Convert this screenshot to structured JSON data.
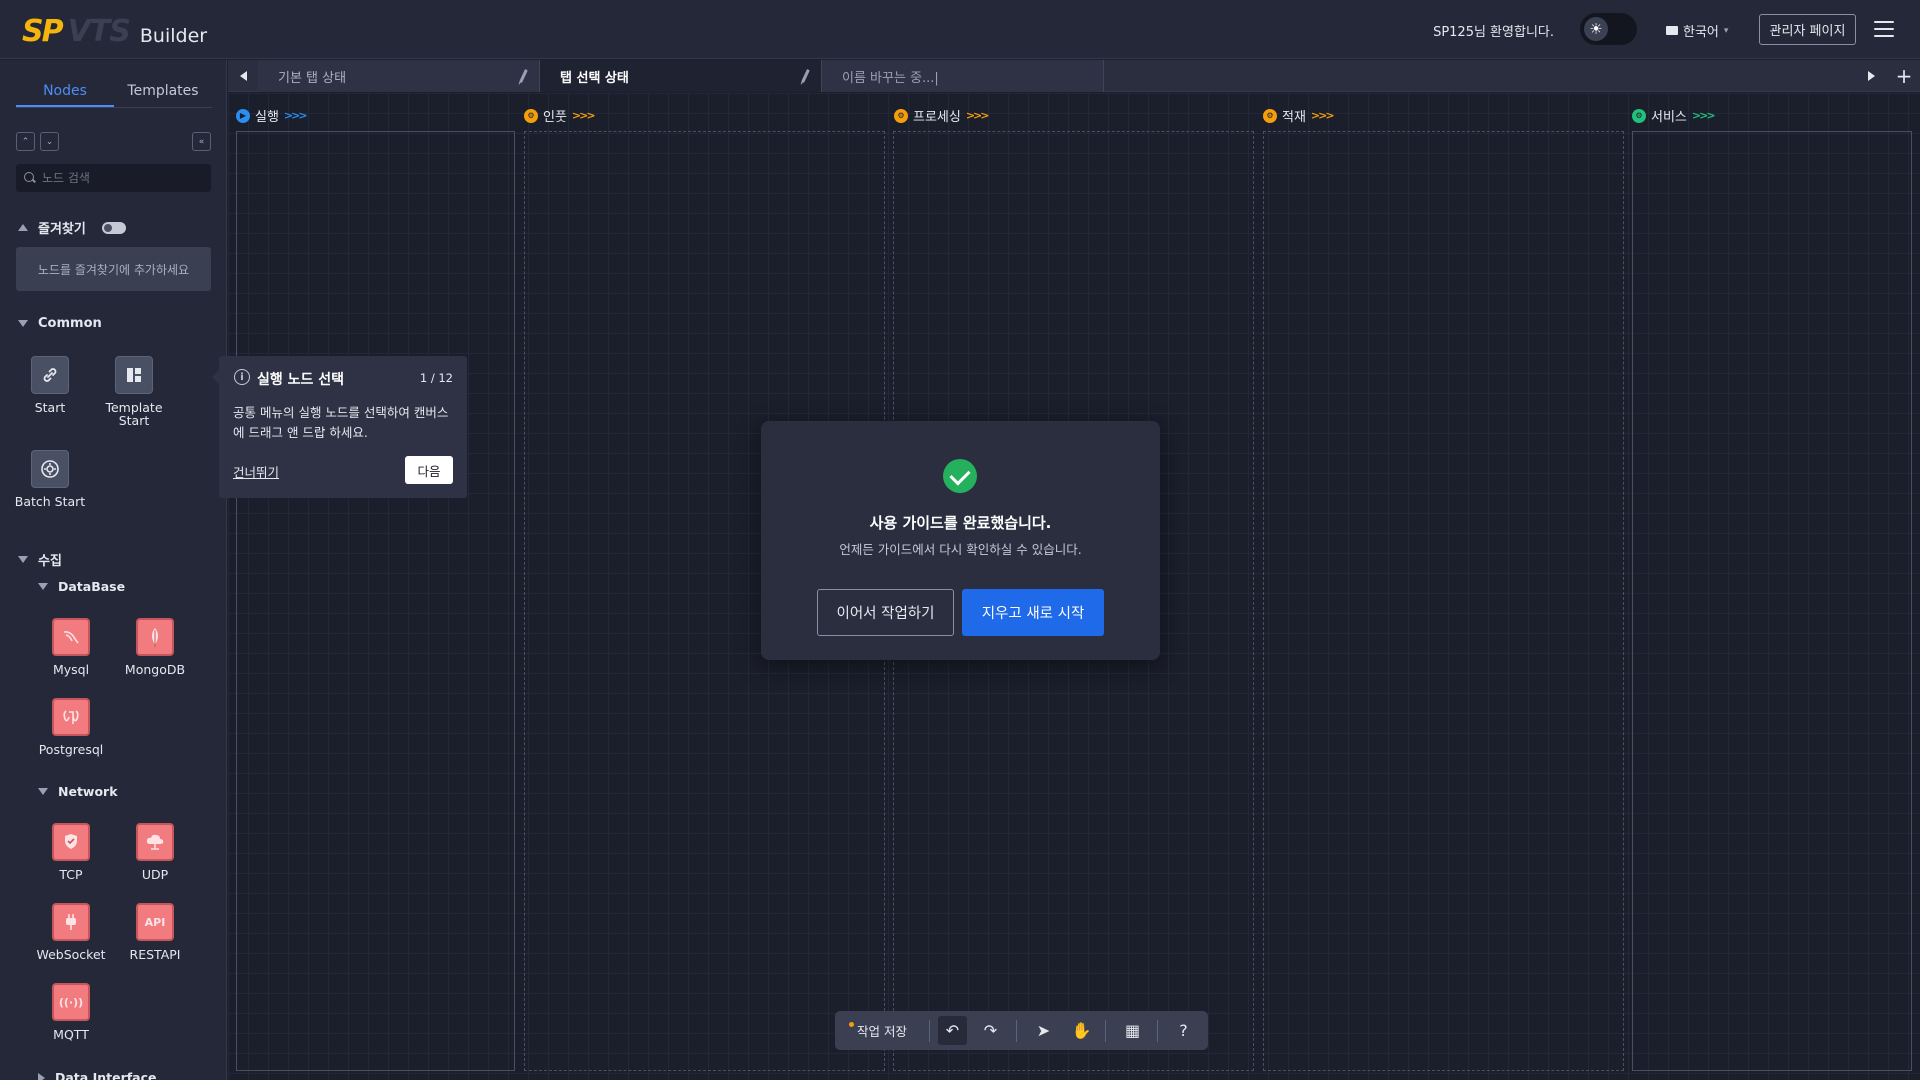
{
  "header": {
    "logo_sp": "SP",
    "logo_vts": "VTS",
    "logo_builder": "Builder",
    "welcome": "SP125님 환영합니다.",
    "language": "한국어",
    "admin_button": "관리자 페이지",
    "theme_icon": "sun-icon"
  },
  "sidebar": {
    "tabs": [
      "Nodes",
      "Templates"
    ],
    "active_tab": "Nodes",
    "search_placeholder": "노드 검색",
    "favorites": {
      "title": "즐겨찾기",
      "empty_message": "노드를 즐겨찾기에 추가하세요"
    },
    "common": {
      "title": "Common",
      "nodes": [
        "Start",
        "Template Start",
        "Batch Start"
      ]
    },
    "collect": {
      "title": "수집",
      "database": {
        "title": "DataBase",
        "nodes": [
          "Mysql",
          "MongoDB",
          "Postgresql"
        ]
      },
      "network": {
        "title": "Network",
        "nodes": [
          "TCP",
          "UDP",
          "WebSocket",
          "RESTAPI",
          "MQTT"
        ]
      },
      "data_interface": {
        "title": "Data Interface"
      }
    }
  },
  "tabs": [
    {
      "label": "기본 탭 상태",
      "state": "inactive"
    },
    {
      "label": "탭 선택 상태",
      "state": "active"
    },
    {
      "label": "이름 바꾸는 중...|",
      "state": "renaming"
    }
  ],
  "lanes": [
    {
      "label": "실행",
      "color": "#2b8ef0"
    },
    {
      "label": "인풋",
      "color": "#f59e0b"
    },
    {
      "label": "프로세싱",
      "color": "#f59e0b"
    },
    {
      "label": "적재",
      "color": "#f59e0b"
    },
    {
      "label": "서비스",
      "color": "#22c07a"
    }
  ],
  "tooltip": {
    "title": "실행 노드 선택",
    "step": "1 / 12",
    "body": "공통 메뉴의 실행 노드를 선택하여 캔버스에 드래그 앤 드랍 하세요.",
    "skip": "건너뛰기",
    "next": "다음"
  },
  "modal": {
    "title": "사용 가이드를 완료했습니다.",
    "subtitle": "언제든 가이드에서 다시 확인하실 수 있습니다.",
    "continue_button": "이어서 작업하기",
    "restart_button": "지우고 새로 시작"
  },
  "toolbar": {
    "save_label": "작업 저장",
    "buttons": [
      "undo-icon",
      "redo-icon",
      "pointer-icon",
      "hand-icon",
      "map-icon",
      "help-icon"
    ]
  }
}
